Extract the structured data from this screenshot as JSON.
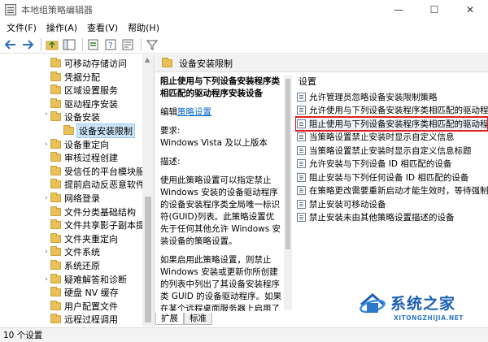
{
  "window": {
    "title": "本地组策略编辑器",
    "controls": {
      "minimize": "—",
      "maximize": "☐",
      "close": "✕"
    }
  },
  "menu": [
    "文件(F)",
    "操作(A)",
    "查看(V)",
    "帮助(H)"
  ],
  "toolbar": [
    "back-icon",
    "forward-icon",
    "up-folder-icon",
    "show-hide-tree-icon",
    "export-icon",
    "help-icon",
    "properties-icon",
    "filter-icon"
  ],
  "tree": {
    "items": [
      {
        "label": "可移动存储访问",
        "indent": 3,
        "caret": ""
      },
      {
        "label": "凭据分配",
        "indent": 3,
        "caret": ""
      },
      {
        "label": "区域设置服务",
        "indent": 3,
        "caret": ""
      },
      {
        "label": "驱动程序安装",
        "indent": 3,
        "caret": ""
      },
      {
        "label": "设备安装",
        "indent": 3,
        "caret": "v"
      },
      {
        "label": "设备安装限制",
        "indent": 4,
        "caret": "",
        "selected": true
      },
      {
        "label": "设备重定向",
        "indent": 3,
        "caret": ">"
      },
      {
        "label": "审核过程创建",
        "indent": 3,
        "caret": ""
      },
      {
        "label": "受信任的平台模块服务",
        "indent": 3,
        "caret": ""
      },
      {
        "label": "提前启动反恶意软件",
        "indent": 3,
        "caret": ""
      },
      {
        "label": "网络登录",
        "indent": 3,
        "caret": ">"
      },
      {
        "label": "文件分类基础结构",
        "indent": 3,
        "caret": ""
      },
      {
        "label": "文件共享影子副本提供",
        "indent": 3,
        "caret": ""
      },
      {
        "label": "文件夹重定向",
        "indent": 3,
        "caret": ""
      },
      {
        "label": "文件系统",
        "indent": 3,
        "caret": ">"
      },
      {
        "label": "系统还原",
        "indent": 3,
        "caret": ""
      },
      {
        "label": "疑难解答和诊断",
        "indent": 3,
        "caret": ">"
      },
      {
        "label": "硬盘 NV 缓存",
        "indent": 3,
        "caret": ""
      },
      {
        "label": "用户配置文件",
        "indent": 3,
        "caret": ""
      },
      {
        "label": "远程过程调用",
        "indent": 3,
        "caret": ""
      }
    ]
  },
  "right_header": "设备安装限制",
  "description": {
    "title": "阻止使用与下列设备安装程序类相匹配的驱动程序安装设备",
    "edit_prefix": "编辑",
    "edit_link": "策略设置",
    "requirements_label": "要求:",
    "requirements_value": "Windows Vista 及以上版本",
    "desc_label": "描述:",
    "desc_p1": "使用此策略设置可以指定禁止 Windows 安装的设备驱动程序的设备安装程序类全局唯一标识符(GUID)列表。此策略设置优先于任何其他允许 Windows 安装设备的策略设置。",
    "desc_p2": "如果启用此策略设置，则禁止 Windows 安装或更新你所创建的列表中列出了其设备安装程序类 GUID 的设备驱动程序。如果在某个远程桌面服务器上启用了此策略设置，则此策略设置会影响将设"
  },
  "settings": {
    "column_header": "设置",
    "items": [
      "允许管理员忽略设备安装限制策略",
      "允许使用与下列设备安装程序类相匹配的驱动程序安",
      "阻止使用与下列设备安装程序类相匹配的驱动程序安",
      "当策略设置禁止安装时显示自定义信息",
      "当策略设置禁止安装时显示自定义信息标题",
      "允许安装与下列设备 ID 相匹配的设备",
      "阻止安装与下列任何设备 ID 相匹配的设备",
      "在策略更改需要重新启动才能生效时，等待强制重新",
      "禁止安装可移动设备",
      "禁止安装未由其他策略设置描述的设备"
    ],
    "highlighted_index": 2
  },
  "tabs": [
    "扩展",
    "标准"
  ],
  "status": "10 个设置",
  "watermark": {
    "text": "系统之家",
    "sub": "XITONGZHIJIA.NET"
  },
  "colors": {
    "highlight_outline": "#e02020",
    "link": "#0066cc",
    "folder": "#e9c158",
    "selection": "#cce4f7"
  }
}
